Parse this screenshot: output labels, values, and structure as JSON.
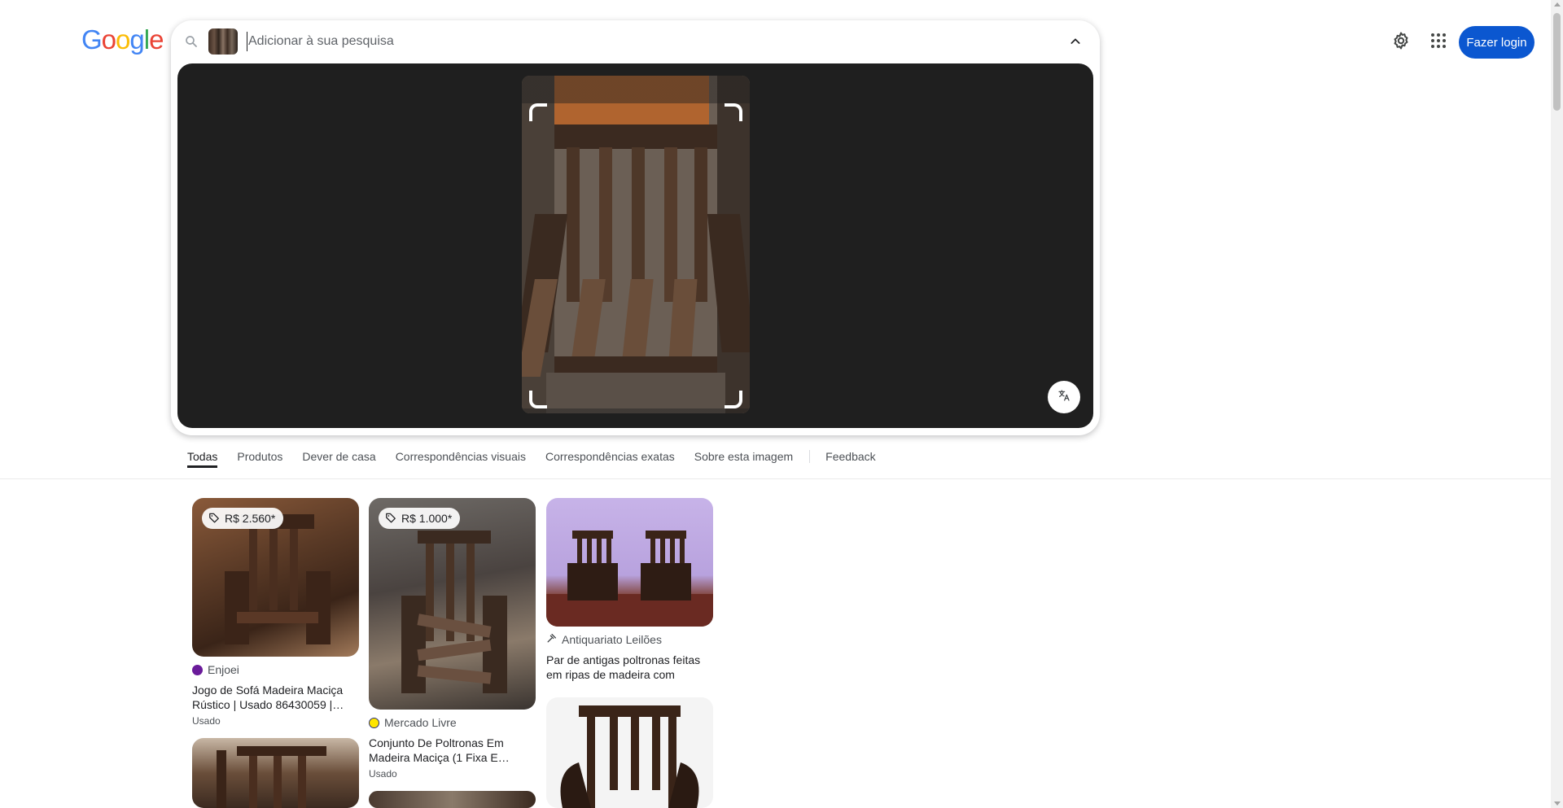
{
  "logo": {
    "letters": [
      "G",
      "o",
      "o",
      "g",
      "l",
      "e"
    ],
    "colors": [
      "#4285F4",
      "#EA4335",
      "#FBBC05",
      "#4285F4",
      "#34A853",
      "#EA4335"
    ]
  },
  "search": {
    "placeholder": "Adicionar à sua pesquisa",
    "value": ""
  },
  "header": {
    "login_label": "Fazer login"
  },
  "accent_color": "#0b57d0",
  "tabs": [
    {
      "label": "Todas",
      "active": true
    },
    {
      "label": "Produtos"
    },
    {
      "label": "Dever de casa"
    },
    {
      "label": "Correspondências visuais"
    },
    {
      "label": "Correspondências exatas"
    },
    {
      "label": "Sobre esta imagem"
    },
    {
      "label": "Feedback"
    }
  ],
  "results": [
    {
      "price": "R$ 2.560*",
      "source": "Enjoei",
      "title": "Jogo de Sofá Madeira Maciça Rústico | Usado 86430059 |…",
      "condition": "Usado"
    },
    {
      "price": "R$ 1.000*",
      "source": "Mercado Livre",
      "title": "Conjunto De Poltronas Em Madeira Maciça (1 Fixa E…",
      "condition": "Usado"
    },
    {
      "source": "Antiquariato Leilões",
      "title": "Par de antigas poltronas feitas em ripas de madeira com"
    }
  ],
  "icons": {
    "search": "search-icon",
    "collapse": "chevron-up-icon",
    "translate": "translate-icon",
    "settings": "gear-icon",
    "apps": "apps-grid-icon",
    "price_tag": "tag-icon"
  }
}
